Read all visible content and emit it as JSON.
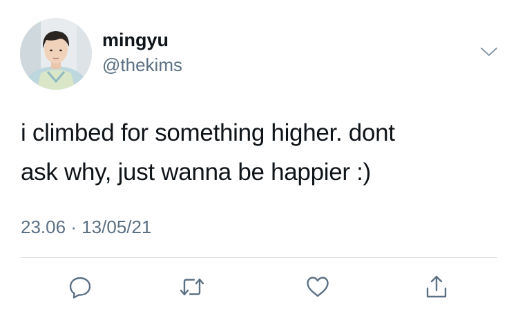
{
  "user": {
    "display_name": "mingyu",
    "handle": "@thekims",
    "avatar_icon": "profile-photo"
  },
  "tweet": {
    "text_lines": [
      "i climbed for something higher. dont",
      "ask why, just wanna be happier :)"
    ],
    "time": "23.06",
    "separator": "·",
    "date": "13/05/21"
  },
  "header": {
    "more_icon": "chevron-down-icon"
  },
  "actions": [
    {
      "name": "reply",
      "icon": "reply-icon"
    },
    {
      "name": "retweet",
      "icon": "retweet-icon"
    },
    {
      "name": "like",
      "icon": "heart-icon"
    },
    {
      "name": "share",
      "icon": "share-icon"
    }
  ],
  "colors": {
    "primary_text": "#0f1419",
    "secondary_text": "#5b7083",
    "divider": "#d6dde3",
    "icon": "#5b7083"
  }
}
